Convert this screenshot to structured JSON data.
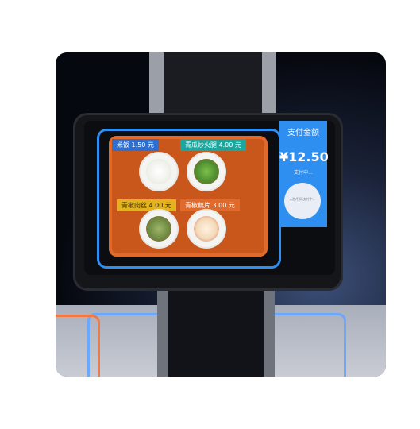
{
  "items": [
    {
      "label": "米饭 1.50 元"
    },
    {
      "label": "青瓜炒火腿 4.00 元"
    },
    {
      "label": "青椒肉丝 4.00 元"
    },
    {
      "label": "青椒藕片 3.00 元"
    }
  ],
  "payment": {
    "title": "支付金额",
    "amount": "¥12.50",
    "status": "支付中...",
    "scan_hint": "人脸/扫码支付中..."
  },
  "colors": {
    "accent_blue": "#2f8ff0",
    "tray_orange": "#c9571c",
    "tag_blue": "#2d6fd1",
    "tag_teal": "#1aa7a0",
    "tag_yellow": "#e2b31f",
    "tag_orange": "#e06a2c"
  }
}
